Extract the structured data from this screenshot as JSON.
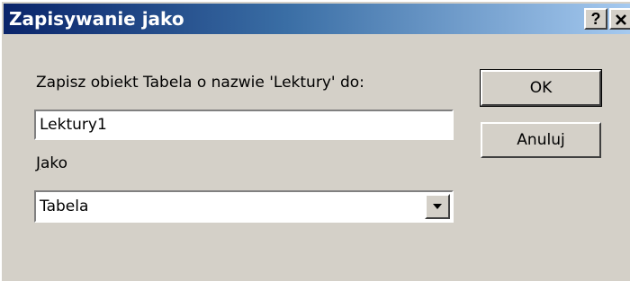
{
  "window": {
    "title": "Zapisywanie jako",
    "help_button": "?",
    "close_button": "✕"
  },
  "form": {
    "prompt": "Zapisz obiekt Tabela o nazwie 'Lektury' do:",
    "name_value": "Lektury1",
    "jako_label_underlined": "J",
    "jako_label_rest": "ako",
    "type_selected": "Tabela"
  },
  "buttons": {
    "ok": "OK",
    "cancel": "Anuluj"
  }
}
